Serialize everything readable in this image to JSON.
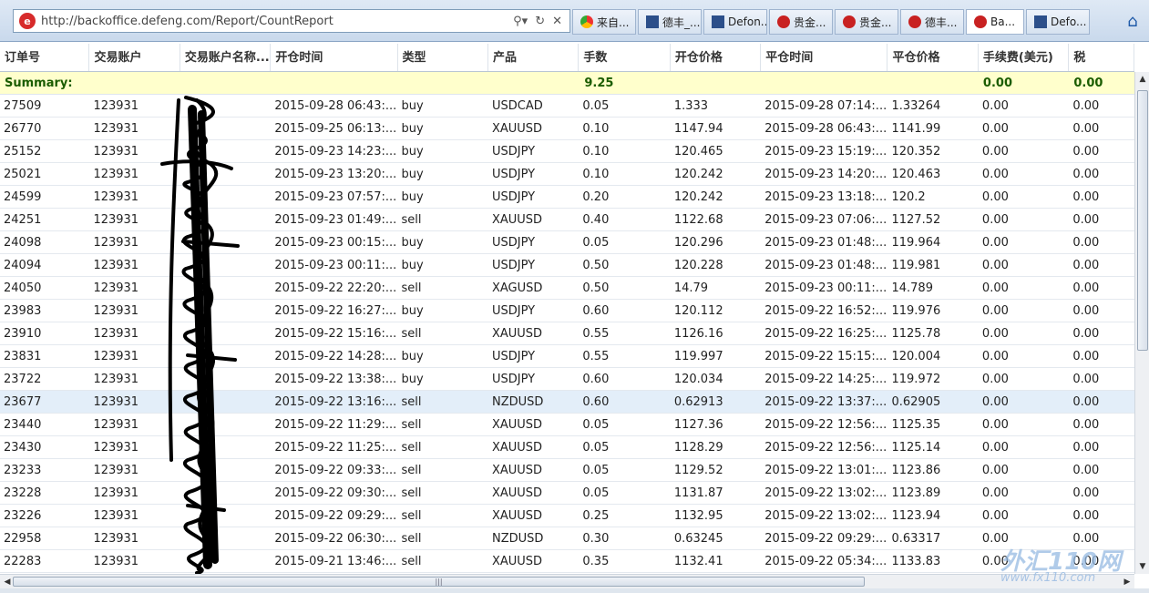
{
  "browser": {
    "url": "http://backoffice.defeng.com/Report/CountReport",
    "tabs": [
      {
        "label": "来自...",
        "icon": "g"
      },
      {
        "label": "德丰_...",
        "icon": "d"
      },
      {
        "label": "Defon...",
        "icon": "d"
      },
      {
        "label": "贵金...",
        "icon": "r"
      },
      {
        "label": "贵金...",
        "icon": "r"
      },
      {
        "label": "德丰...",
        "icon": "r"
      },
      {
        "label": "Ba...",
        "icon": "r",
        "active": true
      },
      {
        "label": "Defo...",
        "icon": "d"
      }
    ]
  },
  "columns": [
    "订单号",
    "交易账户",
    "交易账户名称...",
    "开仓时间",
    "类型",
    "产品",
    "手数",
    "开仓价格",
    "平仓时间",
    "平仓价格",
    "手续费(美元)",
    "税"
  ],
  "summary": {
    "label": "Summary:",
    "lots": "9.25",
    "fee": "0.00",
    "tax": "0.00"
  },
  "rows": [
    [
      "27509",
      "123931",
      "",
      "2015-09-28 06:43:...",
      "buy",
      "USDCAD",
      "0.05",
      "1.333",
      "2015-09-28 07:14:...",
      "1.33264",
      "0.00",
      "0.00"
    ],
    [
      "26770",
      "123931",
      "",
      "2015-09-25 06:13:...",
      "buy",
      "XAUUSD",
      "0.10",
      "1147.94",
      "2015-09-28 06:43:...",
      "1141.99",
      "0.00",
      "0.00"
    ],
    [
      "25152",
      "123931",
      "",
      "2015-09-23 14:23:...",
      "buy",
      "USDJPY",
      "0.10",
      "120.465",
      "2015-09-23 15:19:...",
      "120.352",
      "0.00",
      "0.00"
    ],
    [
      "25021",
      "123931",
      "",
      "2015-09-23 13:20:...",
      "buy",
      "USDJPY",
      "0.10",
      "120.242",
      "2015-09-23 14:20:...",
      "120.463",
      "0.00",
      "0.00"
    ],
    [
      "24599",
      "123931",
      "",
      "2015-09-23 07:57:...",
      "buy",
      "USDJPY",
      "0.20",
      "120.242",
      "2015-09-23 13:18:...",
      "120.2",
      "0.00",
      "0.00"
    ],
    [
      "24251",
      "123931",
      "",
      "2015-09-23 01:49:...",
      "sell",
      "XAUUSD",
      "0.40",
      "1122.68",
      "2015-09-23 07:06:...",
      "1127.52",
      "0.00",
      "0.00"
    ],
    [
      "24098",
      "123931",
      "",
      "2015-09-23 00:15:...",
      "buy",
      "USDJPY",
      "0.05",
      "120.296",
      "2015-09-23 01:48:...",
      "119.964",
      "0.00",
      "0.00"
    ],
    [
      "24094",
      "123931",
      "",
      "2015-09-23 00:11:...",
      "buy",
      "USDJPY",
      "0.50",
      "120.228",
      "2015-09-23 01:48:...",
      "119.981",
      "0.00",
      "0.00"
    ],
    [
      "24050",
      "123931",
      "",
      "2015-09-22 22:20:...",
      "sell",
      "XAGUSD",
      "0.50",
      "14.79",
      "2015-09-23 00:11:...",
      "14.789",
      "0.00",
      "0.00"
    ],
    [
      "23983",
      "123931",
      "",
      "2015-09-22 16:27:...",
      "buy",
      "USDJPY",
      "0.60",
      "120.112",
      "2015-09-22 16:52:...",
      "119.976",
      "0.00",
      "0.00"
    ],
    [
      "23910",
      "123931",
      "",
      "2015-09-22 15:16:...",
      "sell",
      "XAUUSD",
      "0.55",
      "1126.16",
      "2015-09-22 16:25:...",
      "1125.78",
      "0.00",
      "0.00"
    ],
    [
      "23831",
      "123931",
      "",
      "2015-09-22 14:28:...",
      "buy",
      "USDJPY",
      "0.55",
      "119.997",
      "2015-09-22 15:15:...",
      "120.004",
      "0.00",
      "0.00"
    ],
    [
      "23722",
      "123931",
      "",
      "2015-09-22 13:38:...",
      "buy",
      "USDJPY",
      "0.60",
      "120.034",
      "2015-09-22 14:25:...",
      "119.972",
      "0.00",
      "0.00"
    ],
    [
      "23677",
      "123931",
      "",
      "2015-09-22 13:16:...",
      "sell",
      "NZDUSD",
      "0.60",
      "0.62913",
      "2015-09-22 13:37:...",
      "0.62905",
      "0.00",
      "0.00"
    ],
    [
      "23440",
      "123931",
      "",
      "2015-09-22 11:29:...",
      "sell",
      "XAUUSD",
      "0.05",
      "1127.36",
      "2015-09-22 12:56:...",
      "1125.35",
      "0.00",
      "0.00"
    ],
    [
      "23430",
      "123931",
      "",
      "2015-09-22 11:25:...",
      "sell",
      "XAUUSD",
      "0.05",
      "1128.29",
      "2015-09-22 12:56:...",
      "1125.14",
      "0.00",
      "0.00"
    ],
    [
      "23233",
      "123931",
      "",
      "2015-09-22 09:33:...",
      "sell",
      "XAUUSD",
      "0.05",
      "1129.52",
      "2015-09-22 13:01:...",
      "1123.86",
      "0.00",
      "0.00"
    ],
    [
      "23228",
      "123931",
      "",
      "2015-09-22 09:30:...",
      "sell",
      "XAUUSD",
      "0.05",
      "1131.87",
      "2015-09-22 13:02:...",
      "1123.89",
      "0.00",
      "0.00"
    ],
    [
      "23226",
      "123931",
      "",
      "2015-09-22 09:29:...",
      "sell",
      "XAUUSD",
      "0.25",
      "1132.95",
      "2015-09-22 13:02:...",
      "1123.94",
      "0.00",
      "0.00"
    ],
    [
      "22958",
      "123931",
      "",
      "2015-09-22 06:30:...",
      "sell",
      "NZDUSD",
      "0.30",
      "0.63245",
      "2015-09-22 09:29:...",
      "0.63317",
      "0.00",
      "0.00"
    ],
    [
      "22283",
      "123931",
      "",
      "2015-09-21 13:46:...",
      "sell",
      "XAUUSD",
      "0.35",
      "1132.41",
      "2015-09-22 05:34:...",
      "1133.83",
      "0.00",
      "0.00"
    ]
  ],
  "highlighted_row": 13,
  "watermark": {
    "line1": "外汇110网",
    "line2": "www.fx110.com"
  }
}
